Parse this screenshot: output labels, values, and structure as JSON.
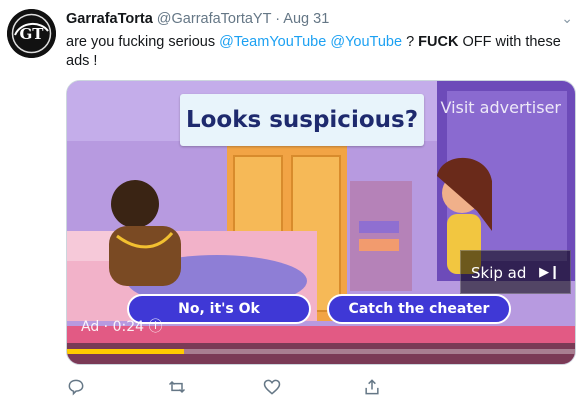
{
  "tweet": {
    "name": "GarrafaTorta",
    "handle": "@GarrafaTortaYT",
    "dot": "·",
    "date": "Aug 31",
    "more": "⌄",
    "text_parts": {
      "t1": "are you fucking serious ",
      "m1": "@TeamYouTube",
      "t2": " ",
      "m2": "@YouTube",
      "t3": " ? ",
      "b1": "FUCK",
      "t4": " OFF with these ads !"
    },
    "avatar_text": "GT"
  },
  "ad": {
    "question": "Looks suspicious?",
    "visit": "Visit advertiser",
    "skip": "Skip ad",
    "choice_1": "No, it's Ok",
    "choice_2": "Catch the cheater",
    "ad_label": "Ad · 0:24",
    "progress": 0.23
  },
  "actions": {
    "reply": "reply-icon",
    "retweet": "retweet-icon",
    "like": "like-icon",
    "share": "share-icon"
  },
  "colors": {
    "mention": "#1da1f2",
    "choice_button": "#3f38d6",
    "progress": "#ffcc00"
  }
}
